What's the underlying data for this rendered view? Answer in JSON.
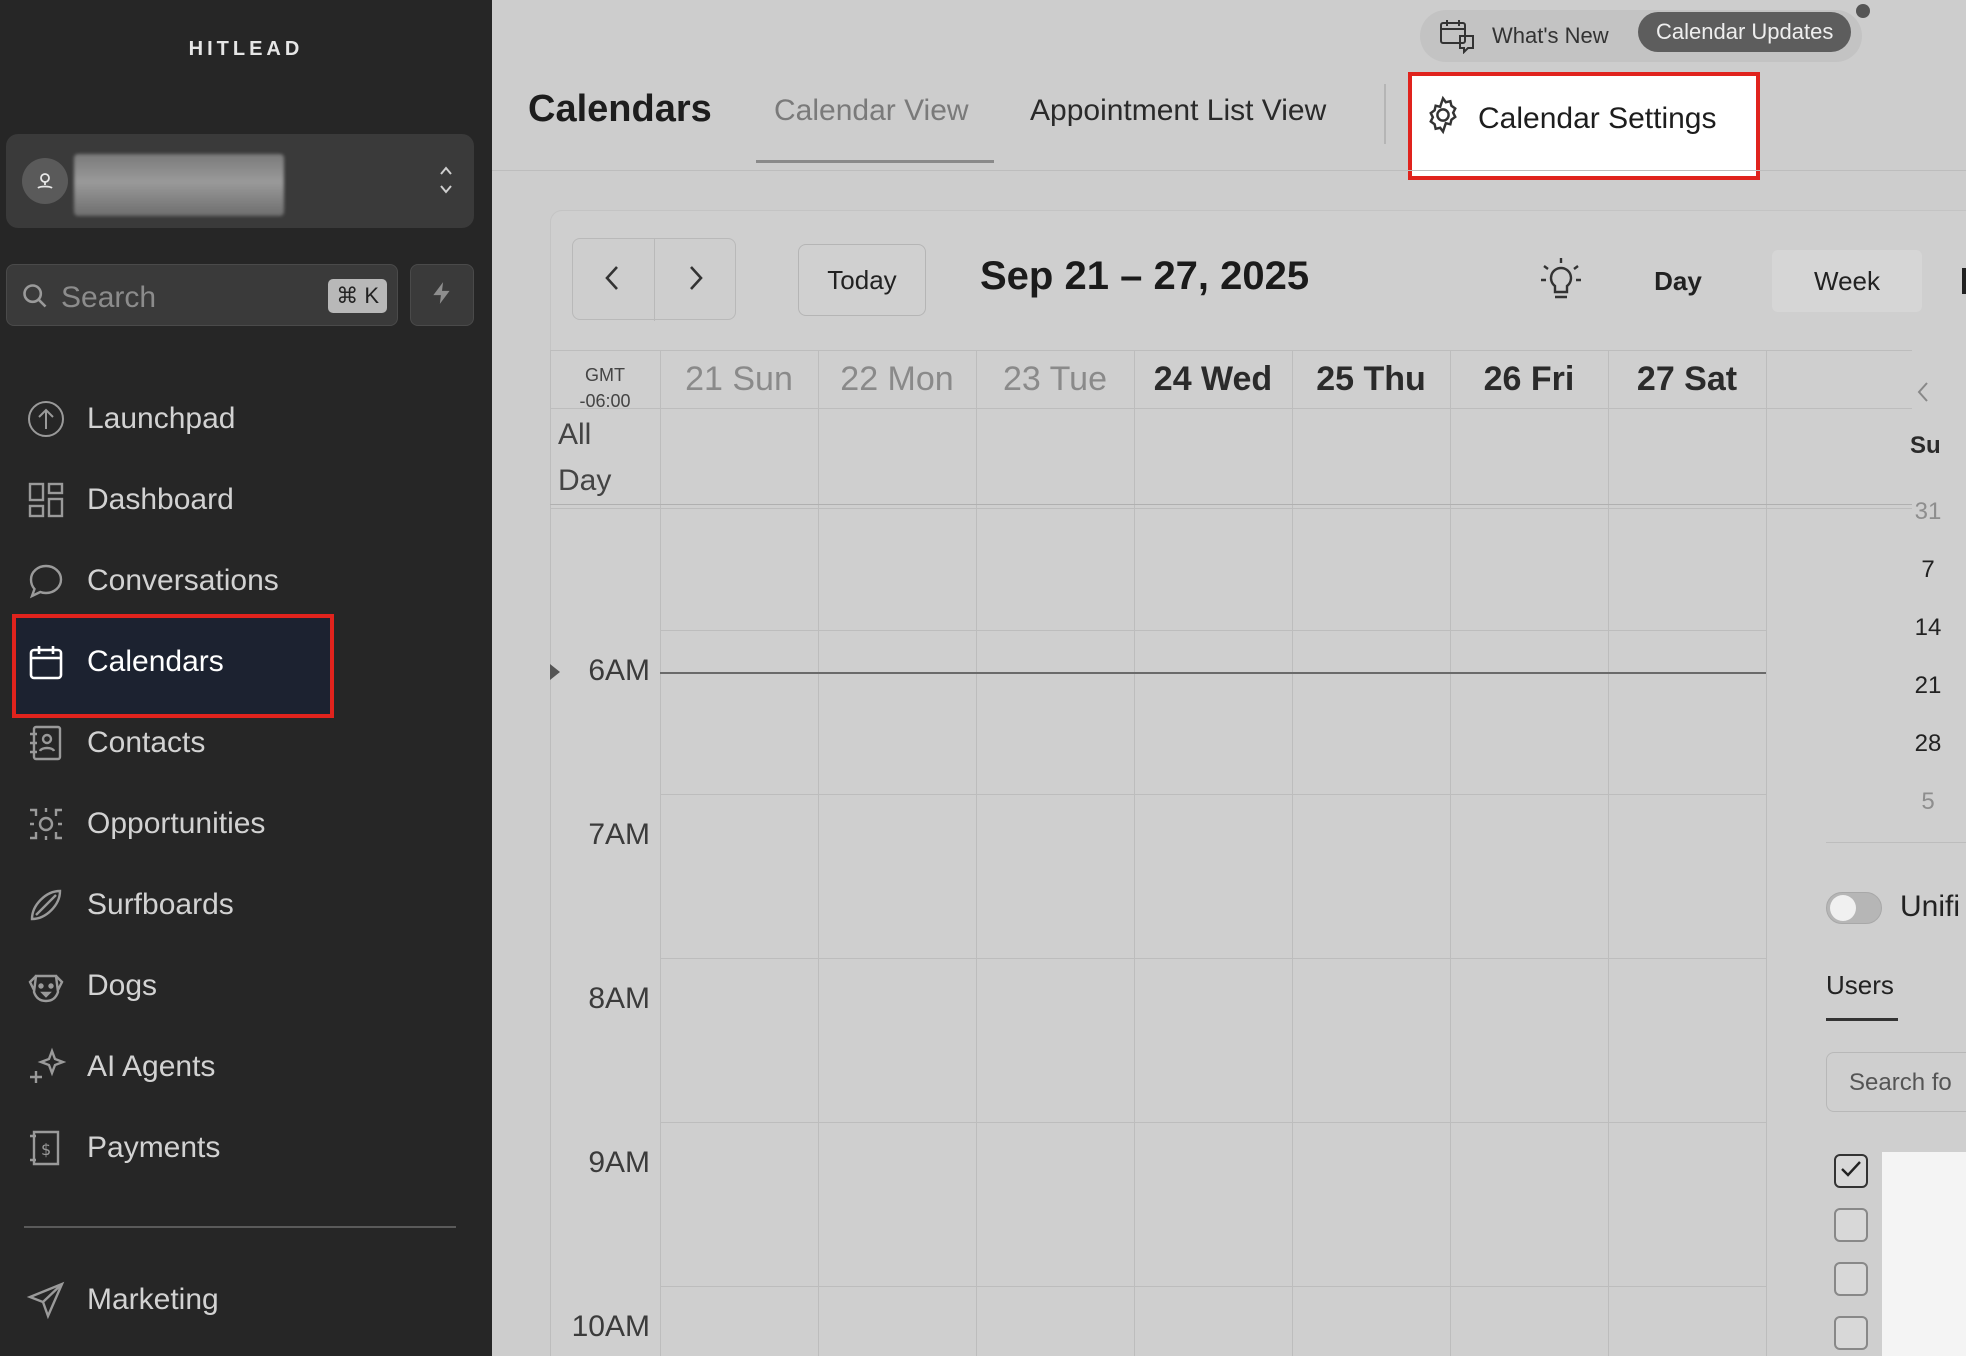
{
  "sidebar": {
    "brand": "HITLEAD",
    "search": {
      "placeholder": "Search",
      "shortcut": "⌘ K"
    },
    "items": [
      {
        "label": "Launchpad",
        "icon": "launchpad-icon"
      },
      {
        "label": "Dashboard",
        "icon": "dashboard-icon"
      },
      {
        "label": "Conversations",
        "icon": "chat-bubble-icon"
      },
      {
        "label": "Calendars",
        "icon": "calendar-icon",
        "active": true
      },
      {
        "label": "Contacts",
        "icon": "contacts-book-icon"
      },
      {
        "label": "Opportunities",
        "icon": "opportunities-icon"
      },
      {
        "label": "Surfboards",
        "icon": "surfboard-icon"
      },
      {
        "label": "Dogs",
        "icon": "dog-icon"
      },
      {
        "label": "AI Agents",
        "icon": "sparkle-icon"
      },
      {
        "label": "Payments",
        "icon": "payment-receipt-icon"
      }
    ],
    "bottom_items": [
      {
        "label": "Marketing",
        "icon": "paper-plane-icon"
      }
    ]
  },
  "topbar": {
    "whats_new": "What's New",
    "calendar_updates": "Calendar Updates"
  },
  "header": {
    "title": "Calendars",
    "tabs": [
      {
        "label": "Calendar View",
        "active": true
      },
      {
        "label": "Appointment List View"
      },
      {
        "label": "Calendar Settings",
        "highlighted": true
      }
    ]
  },
  "calendar": {
    "today_label": "Today",
    "date_range": "Sep 21 – 27, 2025",
    "views": {
      "day": "Day",
      "week": "Week"
    },
    "timezone": [
      "GMT",
      "-06:00"
    ],
    "all_day": [
      "All",
      "Day"
    ],
    "days": [
      {
        "label": "21 Sun",
        "past": true
      },
      {
        "label": "22 Mon",
        "past": true
      },
      {
        "label": "23 Tue",
        "past": true
      },
      {
        "label": "24 Wed",
        "past": false
      },
      {
        "label": "25 Thu",
        "past": false
      },
      {
        "label": "26 Fri",
        "past": false
      },
      {
        "label": "27 Sat",
        "past": false
      }
    ],
    "hours": [
      "6AM",
      "7AM",
      "8AM",
      "9AM",
      "10AM"
    ]
  },
  "mini_calendar": {
    "dow": "Su",
    "days": [
      {
        "label": "31",
        "dim": true
      },
      {
        "label": "7"
      },
      {
        "label": "14"
      },
      {
        "label": "21"
      },
      {
        "label": "28"
      },
      {
        "label": "5",
        "dim": true
      }
    ]
  },
  "filters": {
    "unified_label": "Unifi",
    "users_tab": "Users",
    "search_placeholder": "Search fo"
  },
  "colors": {
    "highlight": "#e0231d",
    "sidebar_bg": "#262626"
  }
}
